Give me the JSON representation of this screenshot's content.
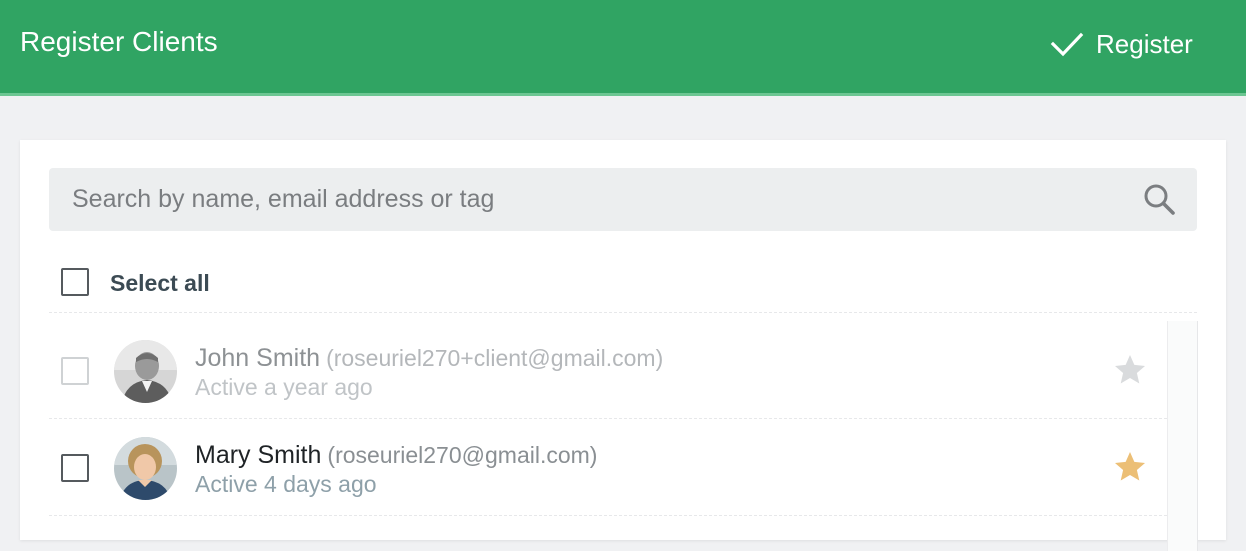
{
  "header": {
    "title": "Register Clients",
    "register_label": "Register",
    "background_color": "#30a463"
  },
  "search": {
    "placeholder": "Search by name, email address or tag",
    "value": ""
  },
  "select_all": {
    "label": "Select all",
    "checked": false
  },
  "clients": [
    {
      "name": "John Smith",
      "email": "(roseuriel270+client@gmail.com)",
      "status": "Active a year ago",
      "checked": false,
      "enabled": false,
      "starred": false,
      "star_color": "#d9dbdd"
    },
    {
      "name": "Mary Smith",
      "email": "(roseuriel270@gmail.com)",
      "status": "Active 4 days ago",
      "checked": false,
      "enabled": true,
      "starred": true,
      "star_color": "#ecbf76"
    }
  ]
}
